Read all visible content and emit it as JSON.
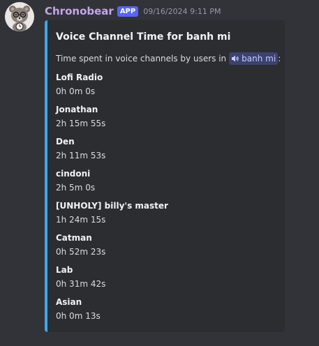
{
  "message": {
    "avatar": "bear-avatar-icon",
    "username": "Chronobear",
    "badge": "APP",
    "timestamp": "09/16/2024 9:11 PM",
    "colors": {
      "username": "#c3a6e8",
      "badge": "#5865f2",
      "embed_accent": "#3ba9e6"
    }
  },
  "embed": {
    "title": "Voice Channel Time for banh mi",
    "description_prefix": "Time spent in voice channels by users in",
    "channel_icon": "speaker-icon",
    "channel_name": "banh mi",
    "description_suffix": ":",
    "fields": [
      {
        "name": "Lofi Radio",
        "value": "0h 0m 0s"
      },
      {
        "name": "Jonathan",
        "value": "2h 15m 55s"
      },
      {
        "name": "Den",
        "value": "2h 11m 53s"
      },
      {
        "name": "cindoni",
        "value": "2h 5m 0s"
      },
      {
        "name": "[UNHOLY] billy's master",
        "value": "1h 24m 15s"
      },
      {
        "name": "Catman",
        "value": "0h 52m 23s"
      },
      {
        "name": "Lab",
        "value": "0h 31m 42s"
      },
      {
        "name": "Asian",
        "value": "0h 0m 13s"
      }
    ]
  }
}
